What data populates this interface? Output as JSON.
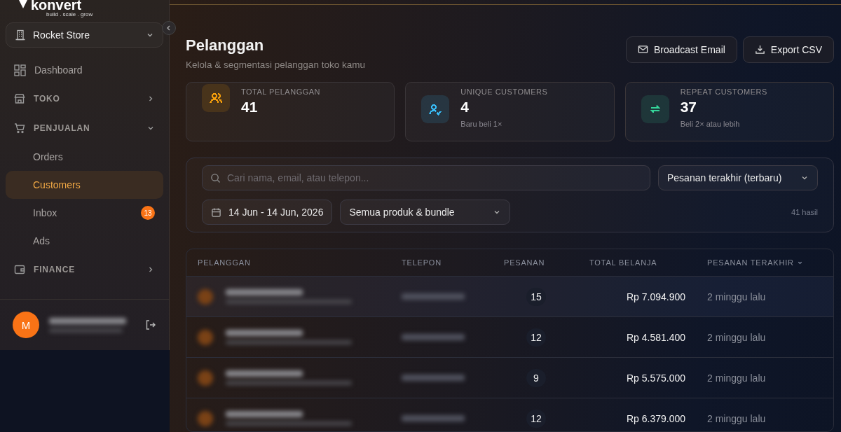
{
  "brand": {
    "name": "konvert",
    "tagline": "build . scale . grow"
  },
  "store_selector": {
    "value": "Rocket Store"
  },
  "sidebar": {
    "items": [
      {
        "kind": "link",
        "label": "Dashboard",
        "selected": false
      },
      {
        "kind": "section",
        "label": "TOKO",
        "expanded": false
      },
      {
        "kind": "section",
        "label": "PENJUALAN",
        "expanded": true,
        "children": [
          {
            "label": "Orders",
            "selected": false
          },
          {
            "label": "Customers",
            "selected": true
          },
          {
            "label": "Inbox",
            "selected": false,
            "badge": "13"
          },
          {
            "label": "Ads",
            "selected": false
          }
        ]
      },
      {
        "kind": "section",
        "label": "FINANCE",
        "expanded": false
      }
    ],
    "user": {
      "initial": "M"
    }
  },
  "page": {
    "title": "Pelanggan",
    "subtitle": "Kelola & segmentasi pelanggan toko kamu",
    "buttons": [
      {
        "label": "Broadcast Email"
      },
      {
        "label": "Export CSV"
      }
    ]
  },
  "stats": [
    {
      "color": "#f59e0b",
      "label": "TOTAL PELANGGAN",
      "value": "41"
    },
    {
      "color": "#38bdf8",
      "label": "UNIQUE CUSTOMERS",
      "value": "4",
      "note": "Baru beli 1×"
    },
    {
      "color": "#34d399",
      "label": "REPEAT CUSTOMERS",
      "value": "37",
      "note": "Beli 2× atau lebih"
    }
  ],
  "filters": {
    "search": {
      "placeholder": "Cari nama, email, atau telepon..."
    },
    "sort": "Pesanan terakhir (terbaru)",
    "date_range": "14 Jun - 14 Jun, 2026",
    "product": "Semua produk & bundle",
    "result_count": "41 hasil"
  },
  "table": {
    "columns": [
      {
        "label": "PELANGGAN",
        "sorted": false
      },
      {
        "label": "TELEPON",
        "sorted": false
      },
      {
        "label": "PESANAN",
        "sorted": false
      },
      {
        "label": "TOTAL BELANJA",
        "sorted": false
      },
      {
        "label": "PESANAN TERAKHIR",
        "sorted": true
      }
    ],
    "rows": [
      {
        "orders": "15",
        "total": "Rp 7.094.900",
        "last_order": "2 minggu lalu",
        "selected": true
      },
      {
        "orders": "12",
        "total": "Rp 4.581.400",
        "last_order": "2 minggu lalu",
        "selected": false
      },
      {
        "orders": "9",
        "total": "Rp 5.575.000",
        "last_order": "2 minggu lalu",
        "selected": false
      },
      {
        "orders": "12",
        "total": "Rp 6.379.000",
        "last_order": "2 minggu lalu",
        "selected": false
      }
    ]
  }
}
